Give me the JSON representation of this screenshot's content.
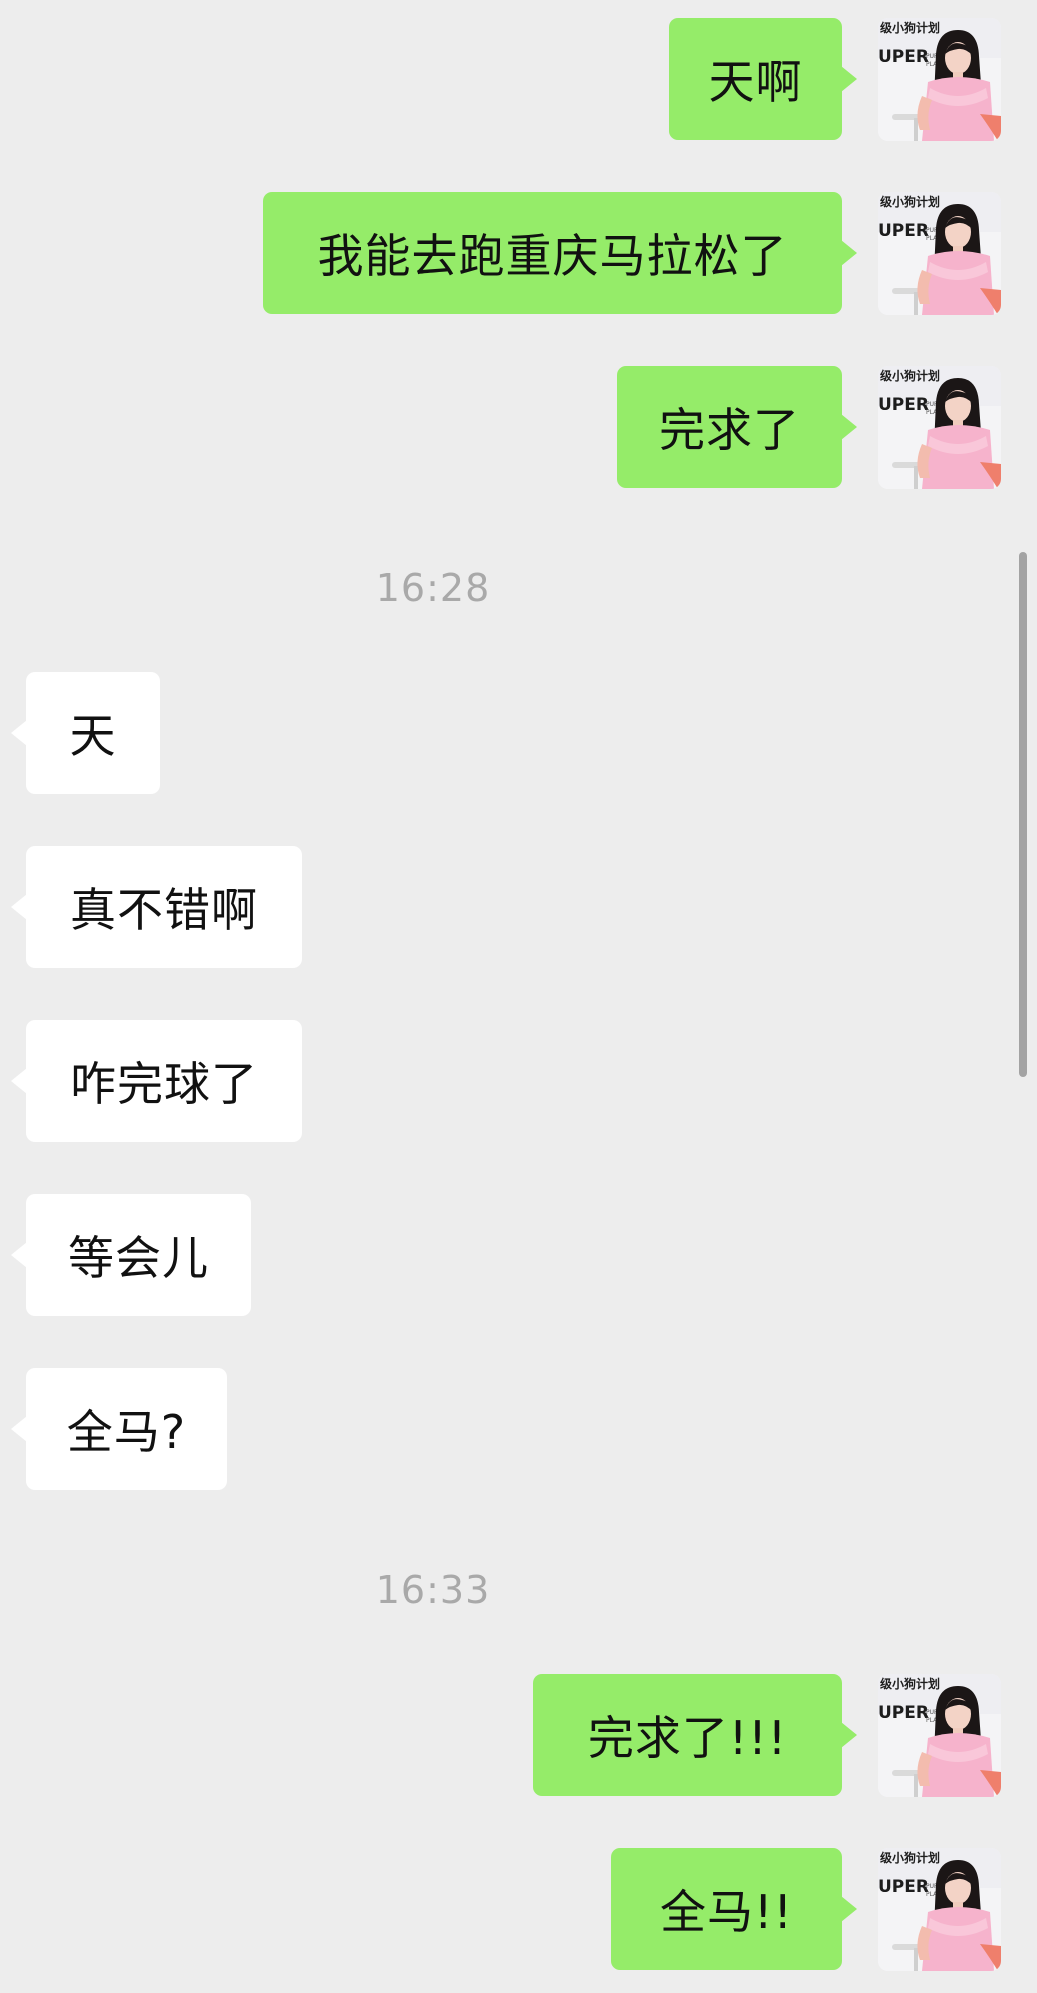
{
  "chat": {
    "messages": [
      {
        "text": "天啊",
        "side": "outgoing"
      },
      {
        "text": "我能去跑重庆马拉松了",
        "side": "outgoing"
      },
      {
        "text": "完求了",
        "side": "outgoing"
      },
      {
        "text": "天",
        "side": "incoming"
      },
      {
        "text": "真不错啊",
        "side": "incoming"
      },
      {
        "text": "咋完球了",
        "side": "incoming"
      },
      {
        "text": "等会儿",
        "side": "incoming"
      },
      {
        "text": "全马?",
        "side": "incoming"
      },
      {
        "text": "完求了!!!",
        "side": "outgoing"
      },
      {
        "text": "全马!!",
        "side": "outgoing"
      }
    ],
    "timestamps": [
      "16:28",
      "16:33"
    ]
  },
  "avatar": {
    "icon": "user-avatar-icon",
    "logo_text": [
      "级小狗计划",
      "UPER"
    ]
  },
  "colors": {
    "background": "#ededed",
    "outgoing_bubble": "#95ec69",
    "incoming_bubble": "#ffffff",
    "timestamp_text": "#a9a9a9",
    "message_text": "#111111"
  }
}
